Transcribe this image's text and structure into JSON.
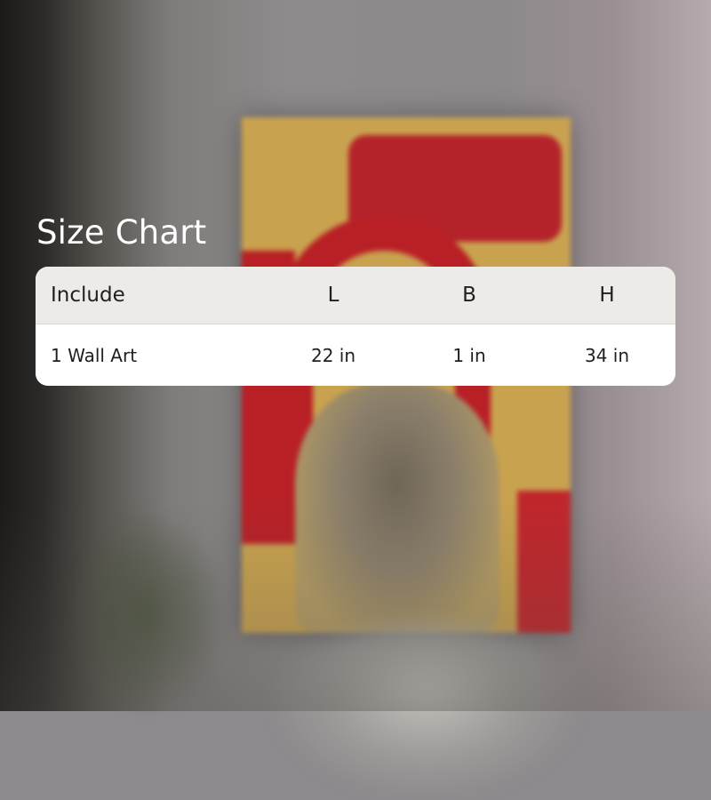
{
  "title": "Size Chart",
  "table": {
    "headers": [
      "Include",
      "L",
      "B",
      "H"
    ],
    "rows": [
      [
        "1 Wall Art",
        "22 in",
        "1 in",
        "34 in"
      ]
    ]
  },
  "colors": {
    "header_bg": "#ecebe7",
    "row_bg": "#ffffff",
    "title_text": "#ffffff",
    "art_red": "#b82026",
    "art_gold": "#c9a24f"
  }
}
